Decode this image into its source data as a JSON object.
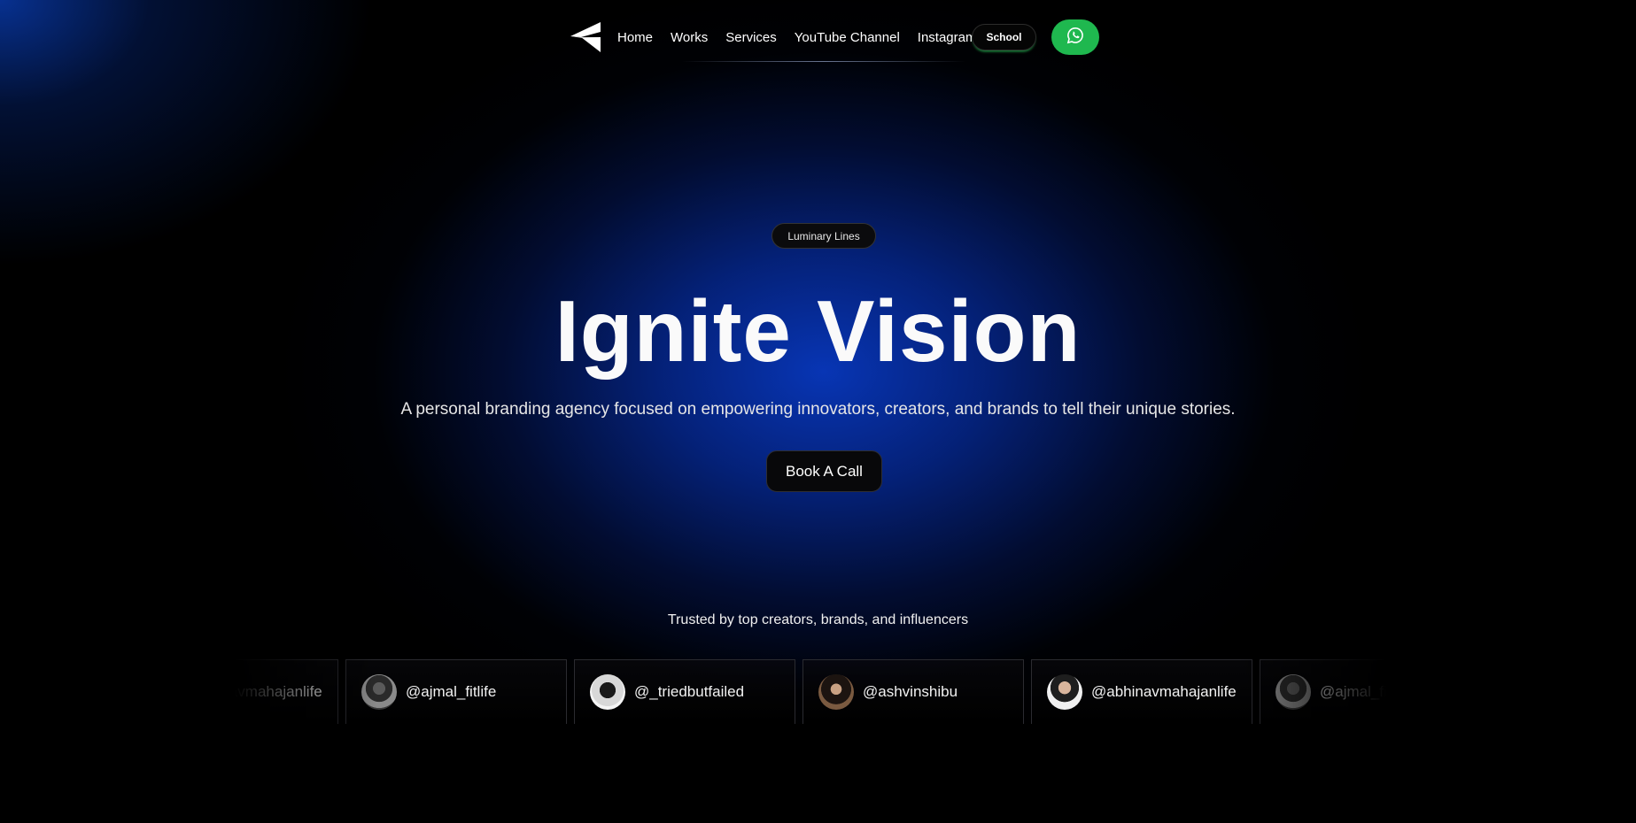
{
  "nav": {
    "links": [
      "Home",
      "Works",
      "Services",
      "YouTube Channel",
      "Instagram"
    ],
    "school_label": "School",
    "whatsapp_icon": "whatsapp-icon",
    "logo_icon": "paper-plane-logo-icon"
  },
  "hero": {
    "badge": "Luminary Lines",
    "title": "Ignite Vision",
    "subtitle": "A personal branding agency focused on empowering innovators, creators, and brands to tell their unique stories.",
    "cta_label": "Book A Call"
  },
  "trusted": {
    "heading": "Trusted by top creators, brands, and influencers",
    "handles": [
      "@abhinavmahajanlife",
      "@ajmal_fitlife",
      "@_triedbutfailed",
      "@ashvinshibu",
      "@abhinavmahajanlife",
      "@ajmal_fitlife"
    ]
  },
  "colors": {
    "accent_whatsapp": "#1fb84f",
    "glow_blue": "#0838be",
    "background": "#000000"
  }
}
